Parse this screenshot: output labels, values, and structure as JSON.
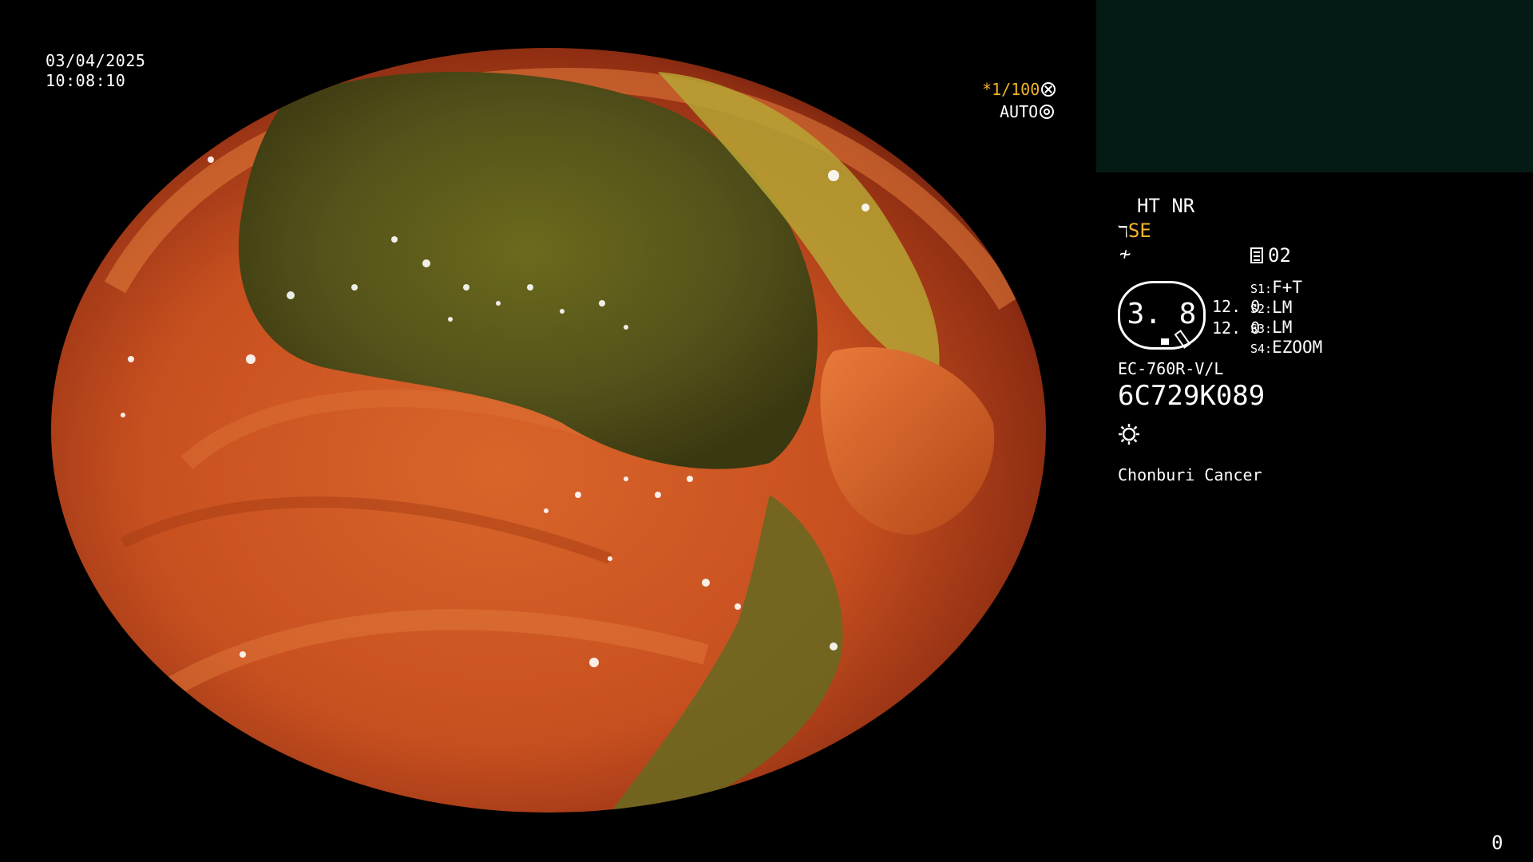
{
  "overlay_left": {
    "date": "03/04/2025",
    "time": "10:08:10"
  },
  "shutter": {
    "speed": "*1/100",
    "speed_icon": "aperture-icon",
    "mode": "AUTO",
    "mode_icon": "iris-icon"
  },
  "settings": {
    "ht_nr": "HT NR",
    "enhancement_icon": "structure-enhance-icon",
    "enhancement": "SE",
    "color_icon": "color-mode-icon",
    "memory_icon": "memory-card-icon",
    "memory_value": "02",
    "gauge_value": "3. 8",
    "gauge_side_top": "12. 0",
    "gauge_side_bottom": "12. 0",
    "switches": [
      {
        "label": "S1:",
        "value": "F+T"
      },
      {
        "label": "S2:",
        "value": "LM"
      },
      {
        "label": "S3:",
        "value": "LM"
      },
      {
        "label": "S4:",
        "value": "EZOOM"
      }
    ],
    "scope_model": "EC-760R-V/L",
    "serial": "6C729K089",
    "light_icon": "brightness-icon",
    "institution": "Chonburi Cancer"
  },
  "corner_counter": "0",
  "colors": {
    "accent": "#f2b428",
    "panel": "#041a15",
    "background": "#000000"
  }
}
